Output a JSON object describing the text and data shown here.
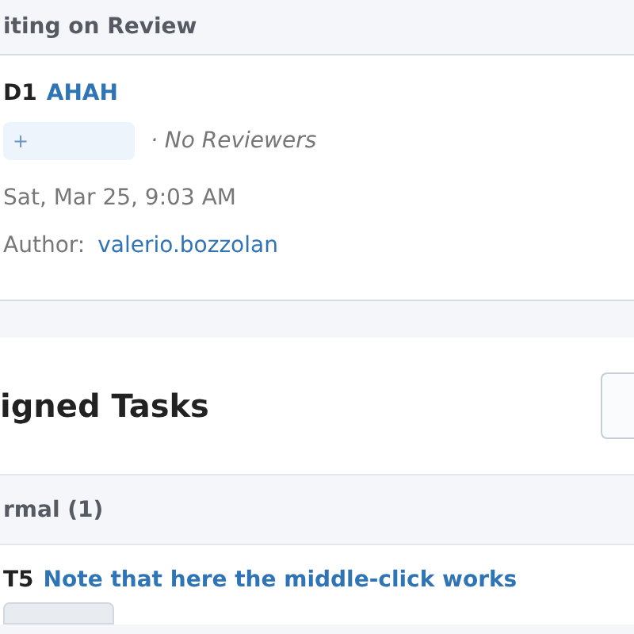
{
  "review_panel": {
    "header": "iting on Review",
    "revisions": [
      {
        "id": "D1",
        "title": "AHAH",
        "tag_symbol": "+",
        "reviewers": "· No Reviewers",
        "date": "Sat, Mar 25, 9:03 AM",
        "author_label": "Author:",
        "author": "valerio.bozzolan"
      }
    ]
  },
  "tasks_panel": {
    "title": "igned Tasks",
    "groups": [
      {
        "label": "rmal (1)",
        "tasks": [
          {
            "id": "T5",
            "title": "Note that here the middle-click works"
          }
        ]
      }
    ]
  }
}
